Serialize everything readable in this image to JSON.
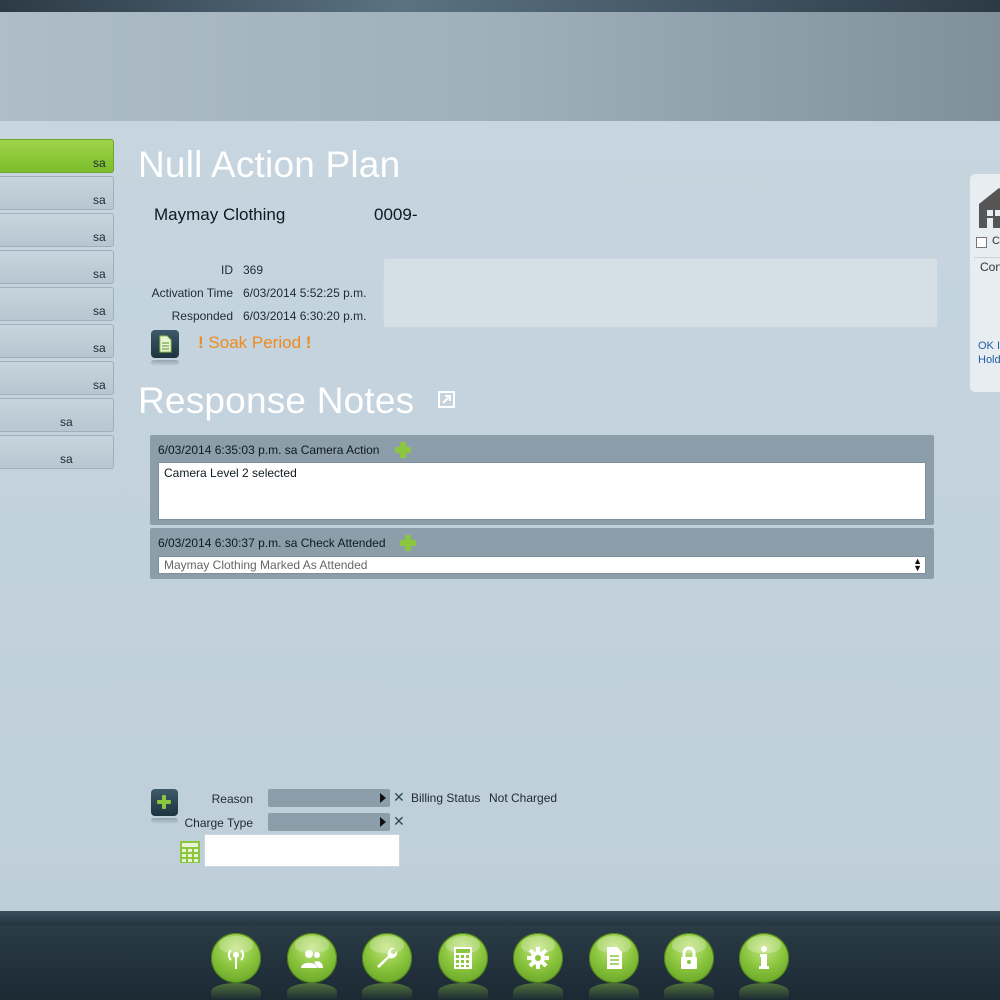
{
  "sidebar": {
    "items": [
      {
        "label": "sa",
        "active": true
      },
      {
        "label": "sa"
      },
      {
        "label": "sa"
      },
      {
        "label": "sa"
      },
      {
        "label": "sa"
      },
      {
        "label": "sa"
      },
      {
        "label": "sa"
      },
      {
        "label": "sa"
      },
      {
        "label": "sa"
      }
    ]
  },
  "main": {
    "title": "Null Action Plan",
    "customer_name": "Maymay Clothing",
    "customer_number": "0009-",
    "info": {
      "id_label": "ID",
      "id_value": "369",
      "activation_label": "Activation Time",
      "activation_value": "6/03/2014 5:52:25 p.m.",
      "responded_label": "Responded",
      "responded_value": "6/03/2014 6:30:20 p.m."
    },
    "status": "Soak Period",
    "status_mark": "!"
  },
  "notes": {
    "title": "Response Notes",
    "items": [
      {
        "header": "6/03/2014 6:35:03 p.m.   sa Camera Action",
        "body": "Camera Level 2 selected"
      },
      {
        "header": "6/03/2014 6:30:37 p.m.   sa Check Attended",
        "value": "Maymay Clothing Marked As Attended"
      }
    ]
  },
  "form": {
    "reason_label": "Reason",
    "charge_type_label": "Charge Type",
    "billing_status_label": "Billing Status",
    "billing_status_value": "Not Charged",
    "clear_mark": "✕"
  },
  "right_panel": {
    "checkbox_label": "C",
    "con_text": "Con",
    "link_line1": "OK I",
    "link_line2": "Hold"
  },
  "footer": {
    "buttons": [
      "signal-icon",
      "users-icon",
      "wrench-icon",
      "calculator-icon",
      "gear-icon",
      "document-icon",
      "lock-icon",
      "info-icon"
    ]
  },
  "colors": {
    "accent_green": "#8cc63f",
    "status_orange": "#f08a1c",
    "background": "#c3d2dc"
  }
}
